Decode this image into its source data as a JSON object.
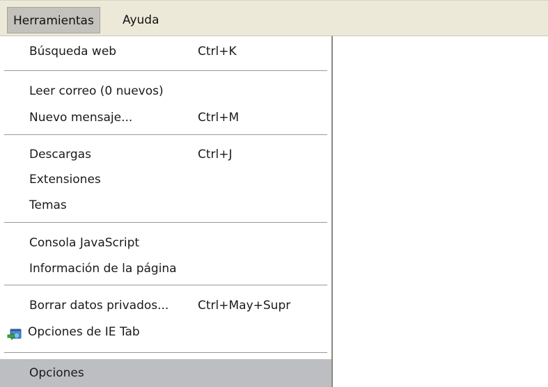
{
  "menubar": {
    "items": [
      {
        "label": "Herramientas"
      },
      {
        "label": "Ayuda"
      }
    ]
  },
  "menu": {
    "items": [
      {
        "label": "Búsqueda web",
        "shortcut": "Ctrl+K"
      },
      {
        "label": "Leer correo (0 nuevos)",
        "shortcut": ""
      },
      {
        "label": "Nuevo mensaje...",
        "shortcut": "Ctrl+M"
      },
      {
        "label": "Descargas",
        "shortcut": "Ctrl+J"
      },
      {
        "label": "Extensiones",
        "shortcut": ""
      },
      {
        "label": "Temas",
        "shortcut": ""
      },
      {
        "label": "Consola JavaScript",
        "shortcut": ""
      },
      {
        "label": "Información de la página",
        "shortcut": ""
      },
      {
        "label": "Borrar datos privados...",
        "shortcut": "Ctrl+May+Supr"
      },
      {
        "label": "Opciones de IE Tab",
        "shortcut": "",
        "icon": "ie-tab-icon"
      },
      {
        "label": "Opciones",
        "shortcut": "",
        "highlighted": true
      }
    ]
  },
  "colors": {
    "menubar_bg": "#ece9d8",
    "highlight_bg": "#bcbec2"
  }
}
